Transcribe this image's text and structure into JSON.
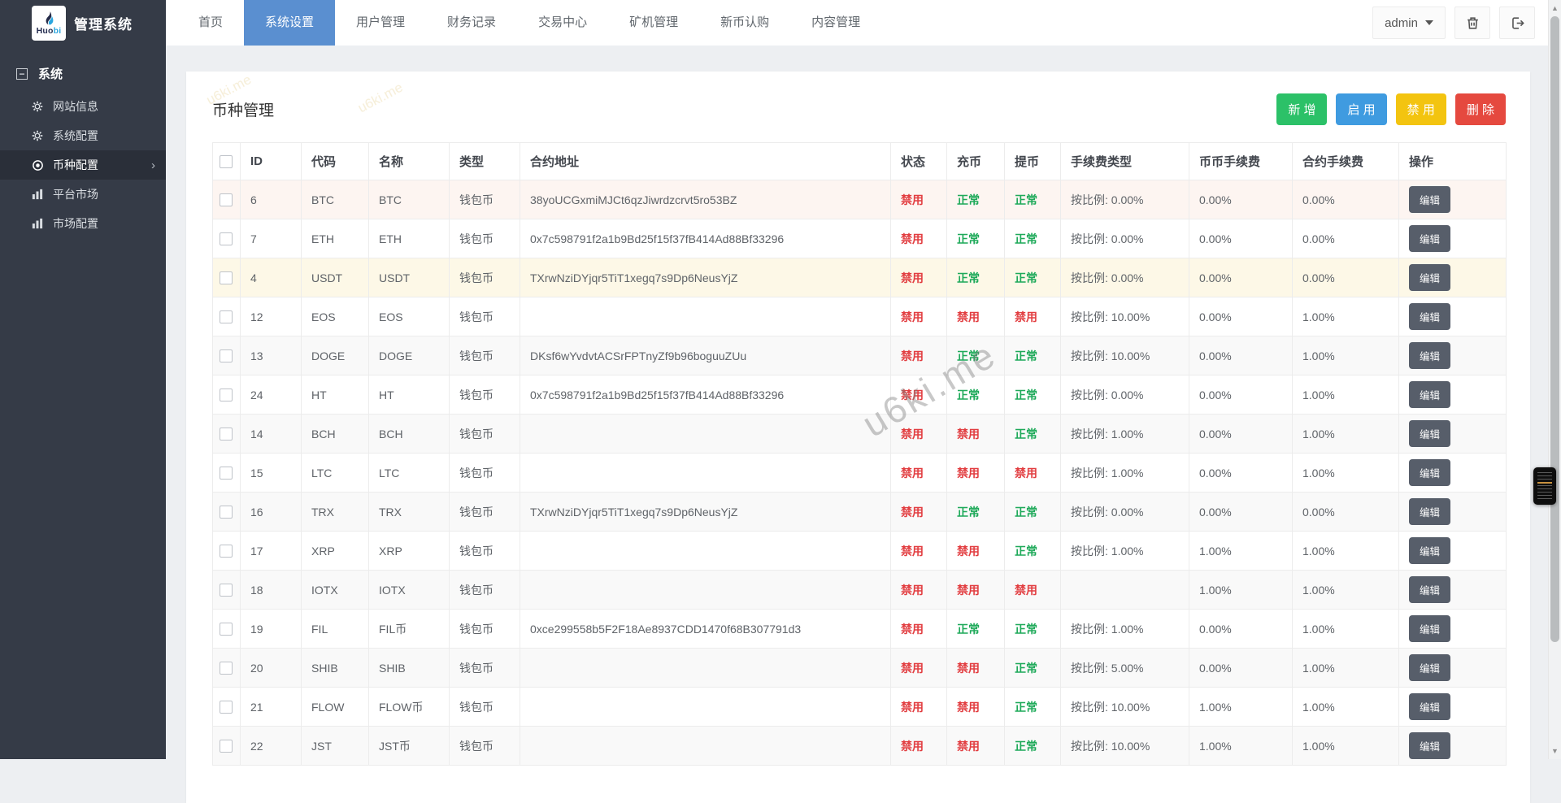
{
  "brand": {
    "logo_text_primary": "Huo",
    "logo_text_accent": "bi",
    "app_title": "管理系统",
    "logo_dark": "#272f52",
    "logo_blue": "#2ba6df"
  },
  "nav": {
    "active_color": "#5a8fd0",
    "tabs": [
      {
        "label": "首页"
      },
      {
        "label": "系统设置",
        "active": true
      },
      {
        "label": "用户管理"
      },
      {
        "label": "财务记录"
      },
      {
        "label": "交易中心"
      },
      {
        "label": "矿机管理"
      },
      {
        "label": "新币认购"
      },
      {
        "label": "内容管理"
      }
    ]
  },
  "topbar": {
    "user": "admin"
  },
  "sidebar": {
    "group_label": "系统",
    "items": [
      {
        "label": "网站信息",
        "icon": "gear-icon"
      },
      {
        "label": "系统配置",
        "icon": "gear-icon"
      },
      {
        "label": "币种配置",
        "icon": "target-icon",
        "active": true
      },
      {
        "label": "平台市场",
        "icon": "bar-chart-icon"
      },
      {
        "label": "市场配置",
        "icon": "bar-chart-icon"
      }
    ]
  },
  "page": {
    "title": "币种管理",
    "buttons": [
      {
        "label": "新 增",
        "color": "#2cc168"
      },
      {
        "label": "启 用",
        "color": "#3f9be0"
      },
      {
        "label": "禁 用",
        "color": "#f3c410"
      },
      {
        "label": "删 除",
        "color": "#e5493f"
      }
    ]
  },
  "status_colors": {
    "normal": "#1faa5a",
    "disabled": "#e23e41"
  },
  "watermark": {
    "text": "u6ki.me"
  },
  "table": {
    "headers": [
      "ID",
      "代码",
      "名称",
      "类型",
      "合约地址",
      "状态",
      "充币",
      "提币",
      "手续费类型",
      "币币手续费",
      "合约手续费",
      "操作"
    ],
    "rows": [
      {
        "id": "6",
        "code": "BTC",
        "name": "BTC",
        "type": "钱包币",
        "contract": "38yoUCGxmiMJCt6qzJiwrdzcrvt5ro53BZ",
        "status": "禁用",
        "deposit": "正常",
        "withdraw": "正常",
        "fee_type": "按比例: 0.00%",
        "coin_fee": "0.00%",
        "contract_fee": "0.00%",
        "action": "编辑",
        "row_bg": "pink"
      },
      {
        "id": "7",
        "code": "ETH",
        "name": "ETH",
        "type": "钱包币",
        "contract": "0x7c598791f2a1b9Bd25f15f37fB414Ad88Bf33296",
        "status": "禁用",
        "deposit": "正常",
        "withdraw": "正常",
        "fee_type": "按比例: 0.00%",
        "coin_fee": "0.00%",
        "contract_fee": "0.00%",
        "action": "编辑",
        "row_bg": ""
      },
      {
        "id": "4",
        "code": "USDT",
        "name": "USDT",
        "type": "钱包币",
        "contract": "TXrwNziDYjqr5TiT1xegq7s9Dp6NeusYjZ",
        "status": "禁用",
        "deposit": "正常",
        "withdraw": "正常",
        "fee_type": "按比例: 0.00%",
        "coin_fee": "0.00%",
        "contract_fee": "0.00%",
        "action": "编辑",
        "row_bg": "cream"
      },
      {
        "id": "12",
        "code": "EOS",
        "name": "EOS",
        "type": "钱包币",
        "contract": "",
        "status": "禁用",
        "deposit": "禁用",
        "withdraw": "禁用",
        "fee_type": "按比例: 10.00%",
        "coin_fee": "0.00%",
        "contract_fee": "1.00%",
        "action": "编辑",
        "row_bg": ""
      },
      {
        "id": "13",
        "code": "DOGE",
        "name": "DOGE",
        "type": "钱包币",
        "contract": "DKsf6wYvdvtACSrFPTnyZf9b96boguuZUu",
        "status": "禁用",
        "deposit": "正常",
        "withdraw": "正常",
        "fee_type": "按比例: 10.00%",
        "coin_fee": "0.00%",
        "contract_fee": "1.00%",
        "action": "编辑",
        "row_bg": "stripe"
      },
      {
        "id": "24",
        "code": "HT",
        "name": "HT",
        "type": "钱包币",
        "contract": "0x7c598791f2a1b9Bd25f15f37fB414Ad88Bf33296",
        "status": "禁用",
        "deposit": "正常",
        "withdraw": "正常",
        "fee_type": "按比例: 0.00%",
        "coin_fee": "0.00%",
        "contract_fee": "1.00%",
        "action": "编辑",
        "row_bg": ""
      },
      {
        "id": "14",
        "code": "BCH",
        "name": "BCH",
        "type": "钱包币",
        "contract": "",
        "status": "禁用",
        "deposit": "禁用",
        "withdraw": "正常",
        "fee_type": "按比例: 1.00%",
        "coin_fee": "0.00%",
        "contract_fee": "1.00%",
        "action": "编辑",
        "row_bg": "stripe"
      },
      {
        "id": "15",
        "code": "LTC",
        "name": "LTC",
        "type": "钱包币",
        "contract": "",
        "status": "禁用",
        "deposit": "禁用",
        "withdraw": "禁用",
        "fee_type": "按比例: 1.00%",
        "coin_fee": "0.00%",
        "contract_fee": "1.00%",
        "action": "编辑",
        "row_bg": ""
      },
      {
        "id": "16",
        "code": "TRX",
        "name": "TRX",
        "type": "钱包币",
        "contract": "TXrwNziDYjqr5TiT1xegq7s9Dp6NeusYjZ",
        "status": "禁用",
        "deposit": "正常",
        "withdraw": "正常",
        "fee_type": "按比例: 0.00%",
        "coin_fee": "0.00%",
        "contract_fee": "0.00%",
        "action": "编辑",
        "row_bg": "stripe"
      },
      {
        "id": "17",
        "code": "XRP",
        "name": "XRP",
        "type": "钱包币",
        "contract": "",
        "status": "禁用",
        "deposit": "禁用",
        "withdraw": "正常",
        "fee_type": "按比例: 1.00%",
        "coin_fee": "1.00%",
        "contract_fee": "1.00%",
        "action": "编辑",
        "row_bg": ""
      },
      {
        "id": "18",
        "code": "IOTX",
        "name": "IOTX",
        "type": "钱包币",
        "contract": "",
        "status": "禁用",
        "deposit": "禁用",
        "withdraw": "禁用",
        "fee_type": "",
        "coin_fee": "1.00%",
        "contract_fee": "1.00%",
        "action": "编辑",
        "row_bg": "stripe"
      },
      {
        "id": "19",
        "code": "FIL",
        "name": "FIL币",
        "type": "钱包币",
        "contract": "0xce299558b5F2F18Ae8937CDD1470f68B307791d3",
        "status": "禁用",
        "deposit": "正常",
        "withdraw": "正常",
        "fee_type": "按比例: 1.00%",
        "coin_fee": "0.00%",
        "contract_fee": "1.00%",
        "action": "编辑",
        "row_bg": ""
      },
      {
        "id": "20",
        "code": "SHIB",
        "name": "SHIB",
        "type": "钱包币",
        "contract": "",
        "status": "禁用",
        "deposit": "禁用",
        "withdraw": "正常",
        "fee_type": "按比例: 5.00%",
        "coin_fee": "0.00%",
        "contract_fee": "1.00%",
        "action": "编辑",
        "row_bg": "stripe"
      },
      {
        "id": "21",
        "code": "FLOW",
        "name": "FLOW币",
        "type": "钱包币",
        "contract": "",
        "status": "禁用",
        "deposit": "禁用",
        "withdraw": "正常",
        "fee_type": "按比例: 10.00%",
        "coin_fee": "1.00%",
        "contract_fee": "1.00%",
        "action": "编辑",
        "row_bg": ""
      },
      {
        "id": "22",
        "code": "JST",
        "name": "JST币",
        "type": "钱包币",
        "contract": "",
        "status": "禁用",
        "deposit": "禁用",
        "withdraw": "正常",
        "fee_type": "按比例: 10.00%",
        "coin_fee": "1.00%",
        "contract_fee": "1.00%",
        "action": "编辑",
        "row_bg": "stripe"
      }
    ]
  }
}
